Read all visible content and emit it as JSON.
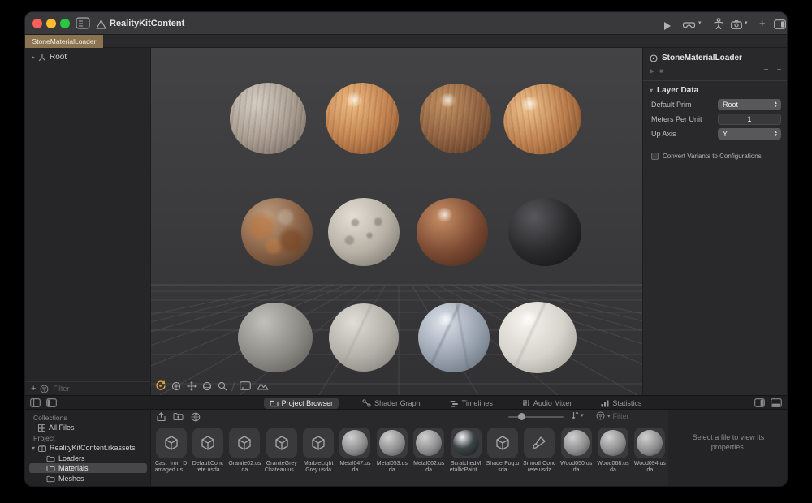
{
  "colors": {
    "tab_active_bg": "#8a7351",
    "tool_active_orange": "#e8a33d",
    "selection_bg": "#47474a",
    "titlebar_bg": "#39393b",
    "traffic_close": "#ff5f57",
    "traffic_min": "#febc2e",
    "traffic_zoom": "#28c840"
  },
  "titlebar": {
    "title": "RealityKitContent"
  },
  "editor_tabs": {
    "active_tab": "StoneMaterialLoader"
  },
  "scene_tree": {
    "root": "Root",
    "filter_placeholder": "Filter",
    "add_label": "+"
  },
  "viewport": {
    "spheres": [
      {
        "name": "wood-grey",
        "hi": "#d4ccc1",
        "base": "#a89c90",
        "dark": "#6b6159"
      },
      {
        "name": "wood-orange",
        "hi": "#edb97f",
        "base": "#c2824f",
        "dark": "#7a4826"
      },
      {
        "name": "wood-brown",
        "hi": "#c29060",
        "base": "#8f6141",
        "dark": "#52331d"
      },
      {
        "name": "wood-orange-egg",
        "hi": "#efc28c",
        "base": "#bc7e4c",
        "dark": "#784824"
      },
      {
        "name": "rusted-iron",
        "hi": "#bd9d80",
        "base": "#8a6347",
        "dark": "#463021"
      },
      {
        "name": "speckled-granite",
        "hi": "#e4dfd5",
        "base": "#b7b1a6",
        "dark": "#6c6860"
      },
      {
        "name": "copper",
        "hi": "#c88f66",
        "base": "#7e4c34",
        "dark": "#3c2216"
      },
      {
        "name": "black-stone",
        "hi": "#58585c",
        "base": "#2a2a2c",
        "dark": "#111113"
      },
      {
        "name": "grey-concrete",
        "hi": "#c2c0ba",
        "base": "#8e8c87",
        "dark": "#55534e"
      },
      {
        "name": "light-concrete",
        "hi": "#e0ddd6",
        "base": "#b4b1aa",
        "dark": "#79766f"
      },
      {
        "name": "blue-marble",
        "hi": "#dde2ea",
        "base": "#9aa3b0",
        "dark": "#5c6571"
      },
      {
        "name": "white-marble",
        "hi": "#f6f4ef",
        "base": "#d6d3cc",
        "dark": "#96928a"
      }
    ]
  },
  "inspector": {
    "title": "StoneMaterialLoader",
    "layer_data": {
      "header": "Layer Data",
      "default_prim_label": "Default Prim",
      "default_prim_value": "Root",
      "meters_per_unit_label": "Meters Per Unit",
      "meters_per_unit_value": "1",
      "up_axis_label": "Up Axis",
      "up_axis_value": "Y",
      "checkbox_label": "Convert Variants to Configurations",
      "checkbox_checked": false
    }
  },
  "bottom_tabs": {
    "project_browser": "Project Browser",
    "shader_graph": "Shader Graph",
    "timelines": "Timelines",
    "audio_mixer": "Audio Mixer",
    "statistics": "Statistics",
    "active": "Project Browser"
  },
  "browser": {
    "sidebar": {
      "collections_header": "Collections",
      "all_files": "All Files",
      "project_header": "Project",
      "root_item": "RealityKitContent.rkassets",
      "loaders": "Loaders",
      "materials": "Materials",
      "meshes": "Meshes",
      "selected": "Materials"
    },
    "toolbar": {
      "filter_placeholder": "Filter"
    },
    "files": [
      {
        "label1": "Cast_Iron_D",
        "label2": "amaged.us...",
        "thumb": "cube"
      },
      {
        "label1": "DefaultConc",
        "label2": "rete.usda",
        "thumb": "cube"
      },
      {
        "label1": "Granite02.us",
        "label2": "da",
        "thumb": "cube"
      },
      {
        "label1": "GraniteGrey",
        "label2": "Chateau.us...",
        "thumb": "cube"
      },
      {
        "label1": "MarbleLight",
        "label2": "Grey.usda",
        "thumb": "cube"
      },
      {
        "label1": "Metal047.us",
        "label2": "da",
        "thumb": "sphere"
      },
      {
        "label1": "Metal053.us",
        "label2": "da",
        "thumb": "sphere"
      },
      {
        "label1": "Metal062.us",
        "label2": "da",
        "thumb": "sphere"
      },
      {
        "label1": "ScratchedM",
        "label2": "etallicPaint...",
        "thumb": "sphere-dark"
      },
      {
        "label1": "ShaderFog.u",
        "label2": "sda",
        "thumb": "cube"
      },
      {
        "label1": "SmoothConc",
        "label2": "rete.usdz",
        "thumb": "brush"
      },
      {
        "label1": "Wood050.us",
        "label2": "da",
        "thumb": "sphere"
      },
      {
        "label1": "Wood068.us",
        "label2": "da",
        "thumb": "sphere"
      },
      {
        "label1": "Wood094.us",
        "label2": "da",
        "thumb": "sphere"
      }
    ],
    "detail_empty_line1": "Select a file to view its",
    "detail_empty_line2": "properties."
  }
}
